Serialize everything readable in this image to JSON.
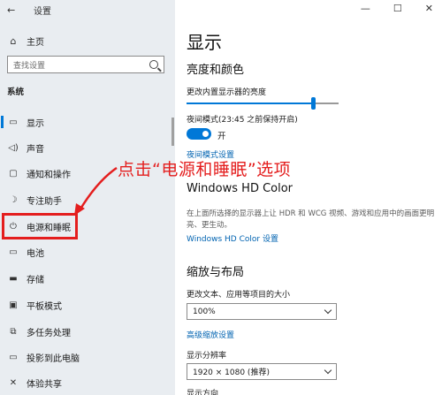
{
  "window": {
    "back_icon": "←",
    "title": "设置",
    "minimize": "—",
    "maximize": "☐",
    "close": "✕"
  },
  "sidebar": {
    "home": {
      "icon": "home-icon",
      "glyph": "⌂",
      "label": "主页"
    },
    "search": {
      "placeholder": "查找设置"
    },
    "section_label": "系统",
    "items": [
      {
        "icon": "display-icon",
        "glyph": "▭",
        "label": "显示"
      },
      {
        "icon": "sound-icon",
        "glyph": "◁)",
        "label": "声音"
      },
      {
        "icon": "notifications-icon",
        "glyph": "▢",
        "label": "通知和操作"
      },
      {
        "icon": "focus-assist-icon",
        "glyph": "☽",
        "label": "专注助手"
      },
      {
        "icon": "power-icon",
        "glyph": "⏻",
        "label": "电源和睡眠"
      },
      {
        "icon": "battery-icon",
        "glyph": "▭",
        "label": "电池"
      },
      {
        "icon": "storage-icon",
        "glyph": "▬",
        "label": "存储"
      },
      {
        "icon": "tablet-icon",
        "glyph": "▣",
        "label": "平板模式"
      },
      {
        "icon": "multitasking-icon",
        "glyph": "⧉",
        "label": "多任务处理"
      },
      {
        "icon": "project-icon",
        "glyph": "▭",
        "label": "投影到此电脑"
      },
      {
        "icon": "shared-experiences-icon",
        "glyph": "✕",
        "label": "体验共享"
      }
    ]
  },
  "main": {
    "page_title": "显示",
    "brightness_section": "亮度和颜色",
    "brightness_label": "更改内置显示器的亮度",
    "brightness_value": 0.83,
    "night_light_label": "夜间模式(23:45 之前保持开启)",
    "night_light_toggle": "开",
    "night_light_link": "夜间模式设置",
    "hd_color_title": "Windows HD Color",
    "hd_color_desc": "在上面所选择的显示器上让 HDR 和 WCG 视频、游戏和应用中的画面更明亮、更生动。",
    "hd_color_link": "Windows HD Color 设置",
    "scale_section": "缩放与布局",
    "scale_label": "更改文本、应用等项目的大小",
    "scale_value": "100%",
    "advanced_scaling_link": "高级缩放设置",
    "resolution_label": "显示分辨率",
    "resolution_value": "1920 × 1080 (推荐)",
    "orientation_label": "显示方向"
  },
  "annotation": {
    "text": "点击“电源和睡眠”选项",
    "color": "#e41e1e"
  },
  "colors": {
    "accent": "#0078d7",
    "link": "#0063b1",
    "sidebar_bg": "#e9edf1"
  }
}
